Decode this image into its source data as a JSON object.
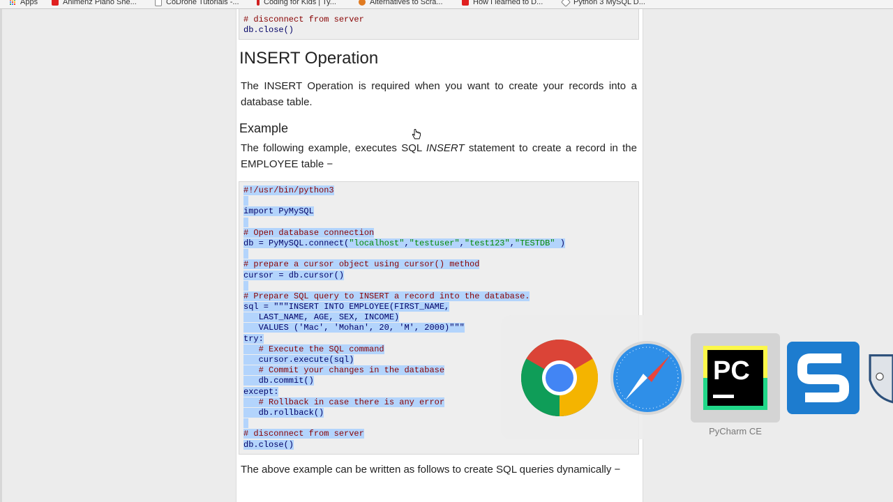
{
  "bookmarks": [
    {
      "label": "Apps",
      "color": "#4a7fd6"
    },
    {
      "label": "Animenz Piano She...",
      "color": "#e02020"
    },
    {
      "label": "CoDrone Tutorials -...",
      "color": "#888888"
    },
    {
      "label": "Coding for Kids | Ty...",
      "color": "#d02020"
    },
    {
      "label": "Alternatives to Scra...",
      "color": "#e07a20"
    },
    {
      "label": "How I learned to D...",
      "color": "#e02020"
    },
    {
      "label": "Python 3 MySQL D...",
      "color": "#777777"
    }
  ],
  "top_code": {
    "line1": "# disconnect from server",
    "line2": "db.close()"
  },
  "section": {
    "title": "INSERT Operation",
    "intro": "The INSERT Operation is required when you want to create your records into a database table.",
    "example_title": "Example",
    "example_text_a": "The following example, executes SQL ",
    "example_text_em": "INSERT",
    "example_text_b": " statement to create a record in the EMPLOYEE table −",
    "after_text": "The above example can be written as follows to create SQL queries dynamically −"
  },
  "code_lines": [
    "#!/usr/bin/python3",
    "",
    "import PyMySQL",
    "",
    "# Open database connection",
    "db = PyMySQL.connect(\"localhost\",\"testuser\",\"test123\",\"TESTDB\" )",
    "",
    "# prepare a cursor object using cursor() method",
    "cursor = db.cursor()",
    "",
    "# Prepare SQL query to INSERT a record into the database.",
    "sql = \"\"\"INSERT INTO EMPLOYEE(FIRST_NAME,",
    "   LAST_NAME, AGE, SEX, INCOME)",
    "   VALUES ('Mac', 'Mohan', 20, 'M', 2000)\"\"\"",
    "try:",
    "   # Execute the SQL command",
    "   cursor.execute(sql)",
    "   # Commit your changes in the database",
    "   db.commit()",
    "except:",
    "   # Rollback in case there is any error",
    "   db.rollback()",
    "",
    "# disconnect from server",
    "db.close()"
  ],
  "app_switcher": {
    "apps": [
      {
        "name": "Google Chrome",
        "icon": "chrome-icon"
      },
      {
        "name": "Safari",
        "icon": "safari-icon"
      },
      {
        "name": "PyCharm CE",
        "icon": "pycharm-icon"
      },
      {
        "name": "Snagit",
        "icon": "snagit-icon"
      },
      {
        "name": "Shield",
        "icon": "shield-app-icon"
      }
    ],
    "selected_label": "PyCharm CE"
  },
  "colors": {
    "code_comment": "#880000",
    "code_plain": "#000066",
    "code_string": "#008800",
    "selection": "#b3d4fc"
  }
}
